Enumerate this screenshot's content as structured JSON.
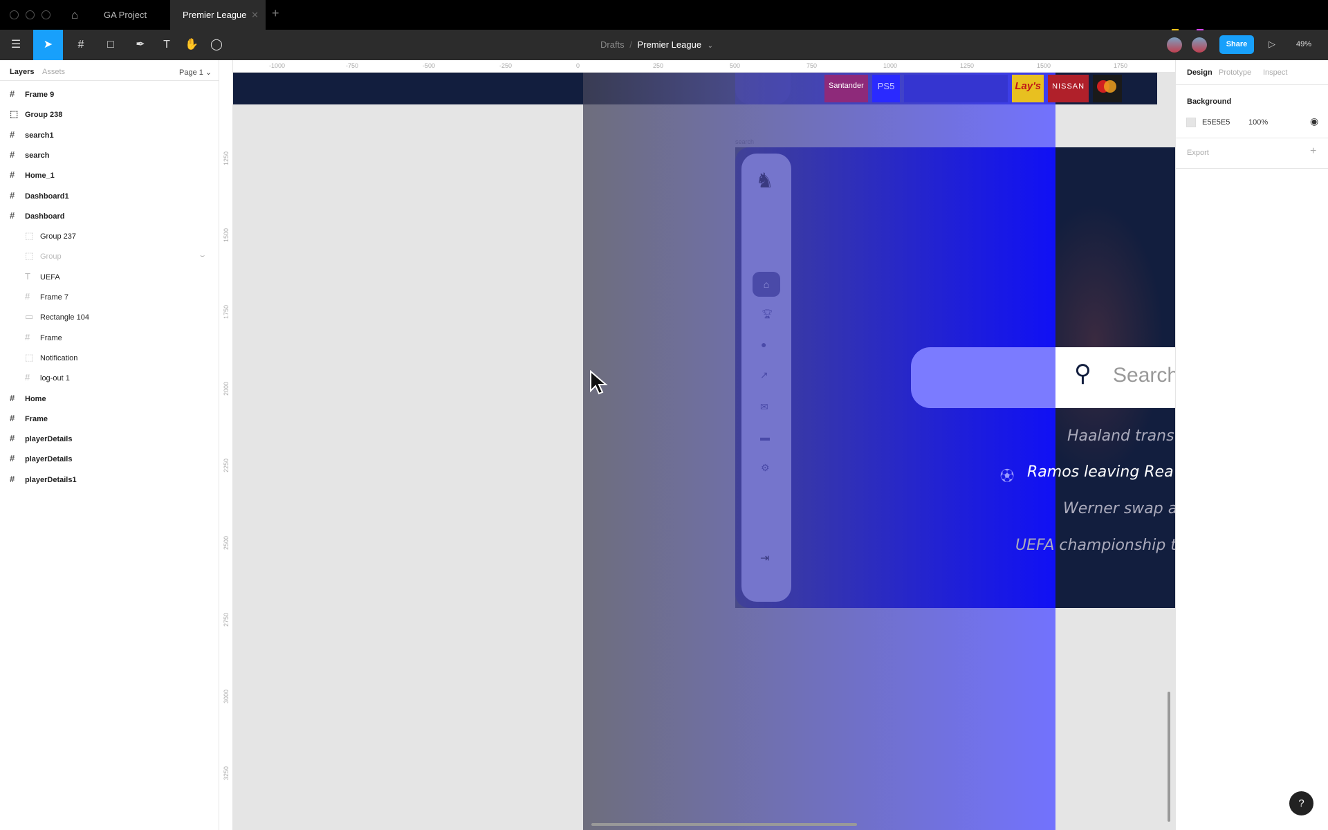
{
  "tabs": {
    "project": "GA Project",
    "active": "Premier League"
  },
  "toolbar": {
    "breadcrumb_root": "Drafts",
    "breadcrumb_sep": "/",
    "file_name": "Premier League",
    "share": "Share",
    "zoom": "49%"
  },
  "left_panel": {
    "tab_layers": "Layers",
    "tab_assets": "Assets",
    "page": "Page 1",
    "layers": [
      {
        "name": "Frame 9",
        "type": "frame",
        "level": 0
      },
      {
        "name": "Group 238",
        "type": "group",
        "level": 0
      },
      {
        "name": "search1",
        "type": "frame",
        "level": 0
      },
      {
        "name": "search",
        "type": "frame",
        "level": 0
      },
      {
        "name": "Home_1",
        "type": "frame",
        "level": 0
      },
      {
        "name": "Dashboard1",
        "type": "frame",
        "level": 0
      },
      {
        "name": "Dashboard",
        "type": "frame",
        "level": 0
      },
      {
        "name": "Group 237",
        "type": "group",
        "level": 1
      },
      {
        "name": "Group",
        "type": "group",
        "level": 1,
        "hidden": true
      },
      {
        "name": "UEFA",
        "type": "text",
        "level": 1
      },
      {
        "name": "Frame 7",
        "type": "frame",
        "level": 1
      },
      {
        "name": "Rectangle 104",
        "type": "rect",
        "level": 1
      },
      {
        "name": "Frame",
        "type": "frame",
        "level": 1
      },
      {
        "name": "Notification",
        "type": "group",
        "level": 1
      },
      {
        "name": "log-out 1",
        "type": "frame",
        "level": 1
      },
      {
        "name": "Home",
        "type": "frame",
        "level": 0
      },
      {
        "name": "Frame",
        "type": "frame",
        "level": 0
      },
      {
        "name": "playerDetails",
        "type": "frame",
        "level": 0
      },
      {
        "name": "playerDetails",
        "type": "frame",
        "level": 0
      },
      {
        "name": "playerDetails1",
        "type": "frame",
        "level": 0
      }
    ]
  },
  "rulers": {
    "h": [
      "-1000",
      "-750",
      "-500",
      "-250",
      "0",
      "250",
      "500",
      "750",
      "1000",
      "1250",
      "1500",
      "1750"
    ],
    "v": [
      "1250",
      "1500",
      "1750",
      "2000",
      "2250",
      "2500",
      "2750",
      "3000",
      "3250"
    ]
  },
  "canvas": {
    "frame_label": "search",
    "search_placeholder": "Search",
    "sponsors": [
      "Santander",
      "PS5",
      "Lay's",
      "NISSAN"
    ],
    "results": [
      "Haaland trans",
      "Ramos leaving Rea",
      "Werner swap a",
      "UEFA championship t"
    ]
  },
  "right_panel": {
    "tab_design": "Design",
    "tab_prototype": "Prototype",
    "tab_inspect": "Inspect",
    "background_label": "Background",
    "bg_hex": "E5E5E5",
    "bg_opacity": "100%",
    "export_label": "Export"
  },
  "colors": {
    "accent": "#18a0fb",
    "canvas": "#e5e5e5",
    "navy": "#121e3e"
  }
}
